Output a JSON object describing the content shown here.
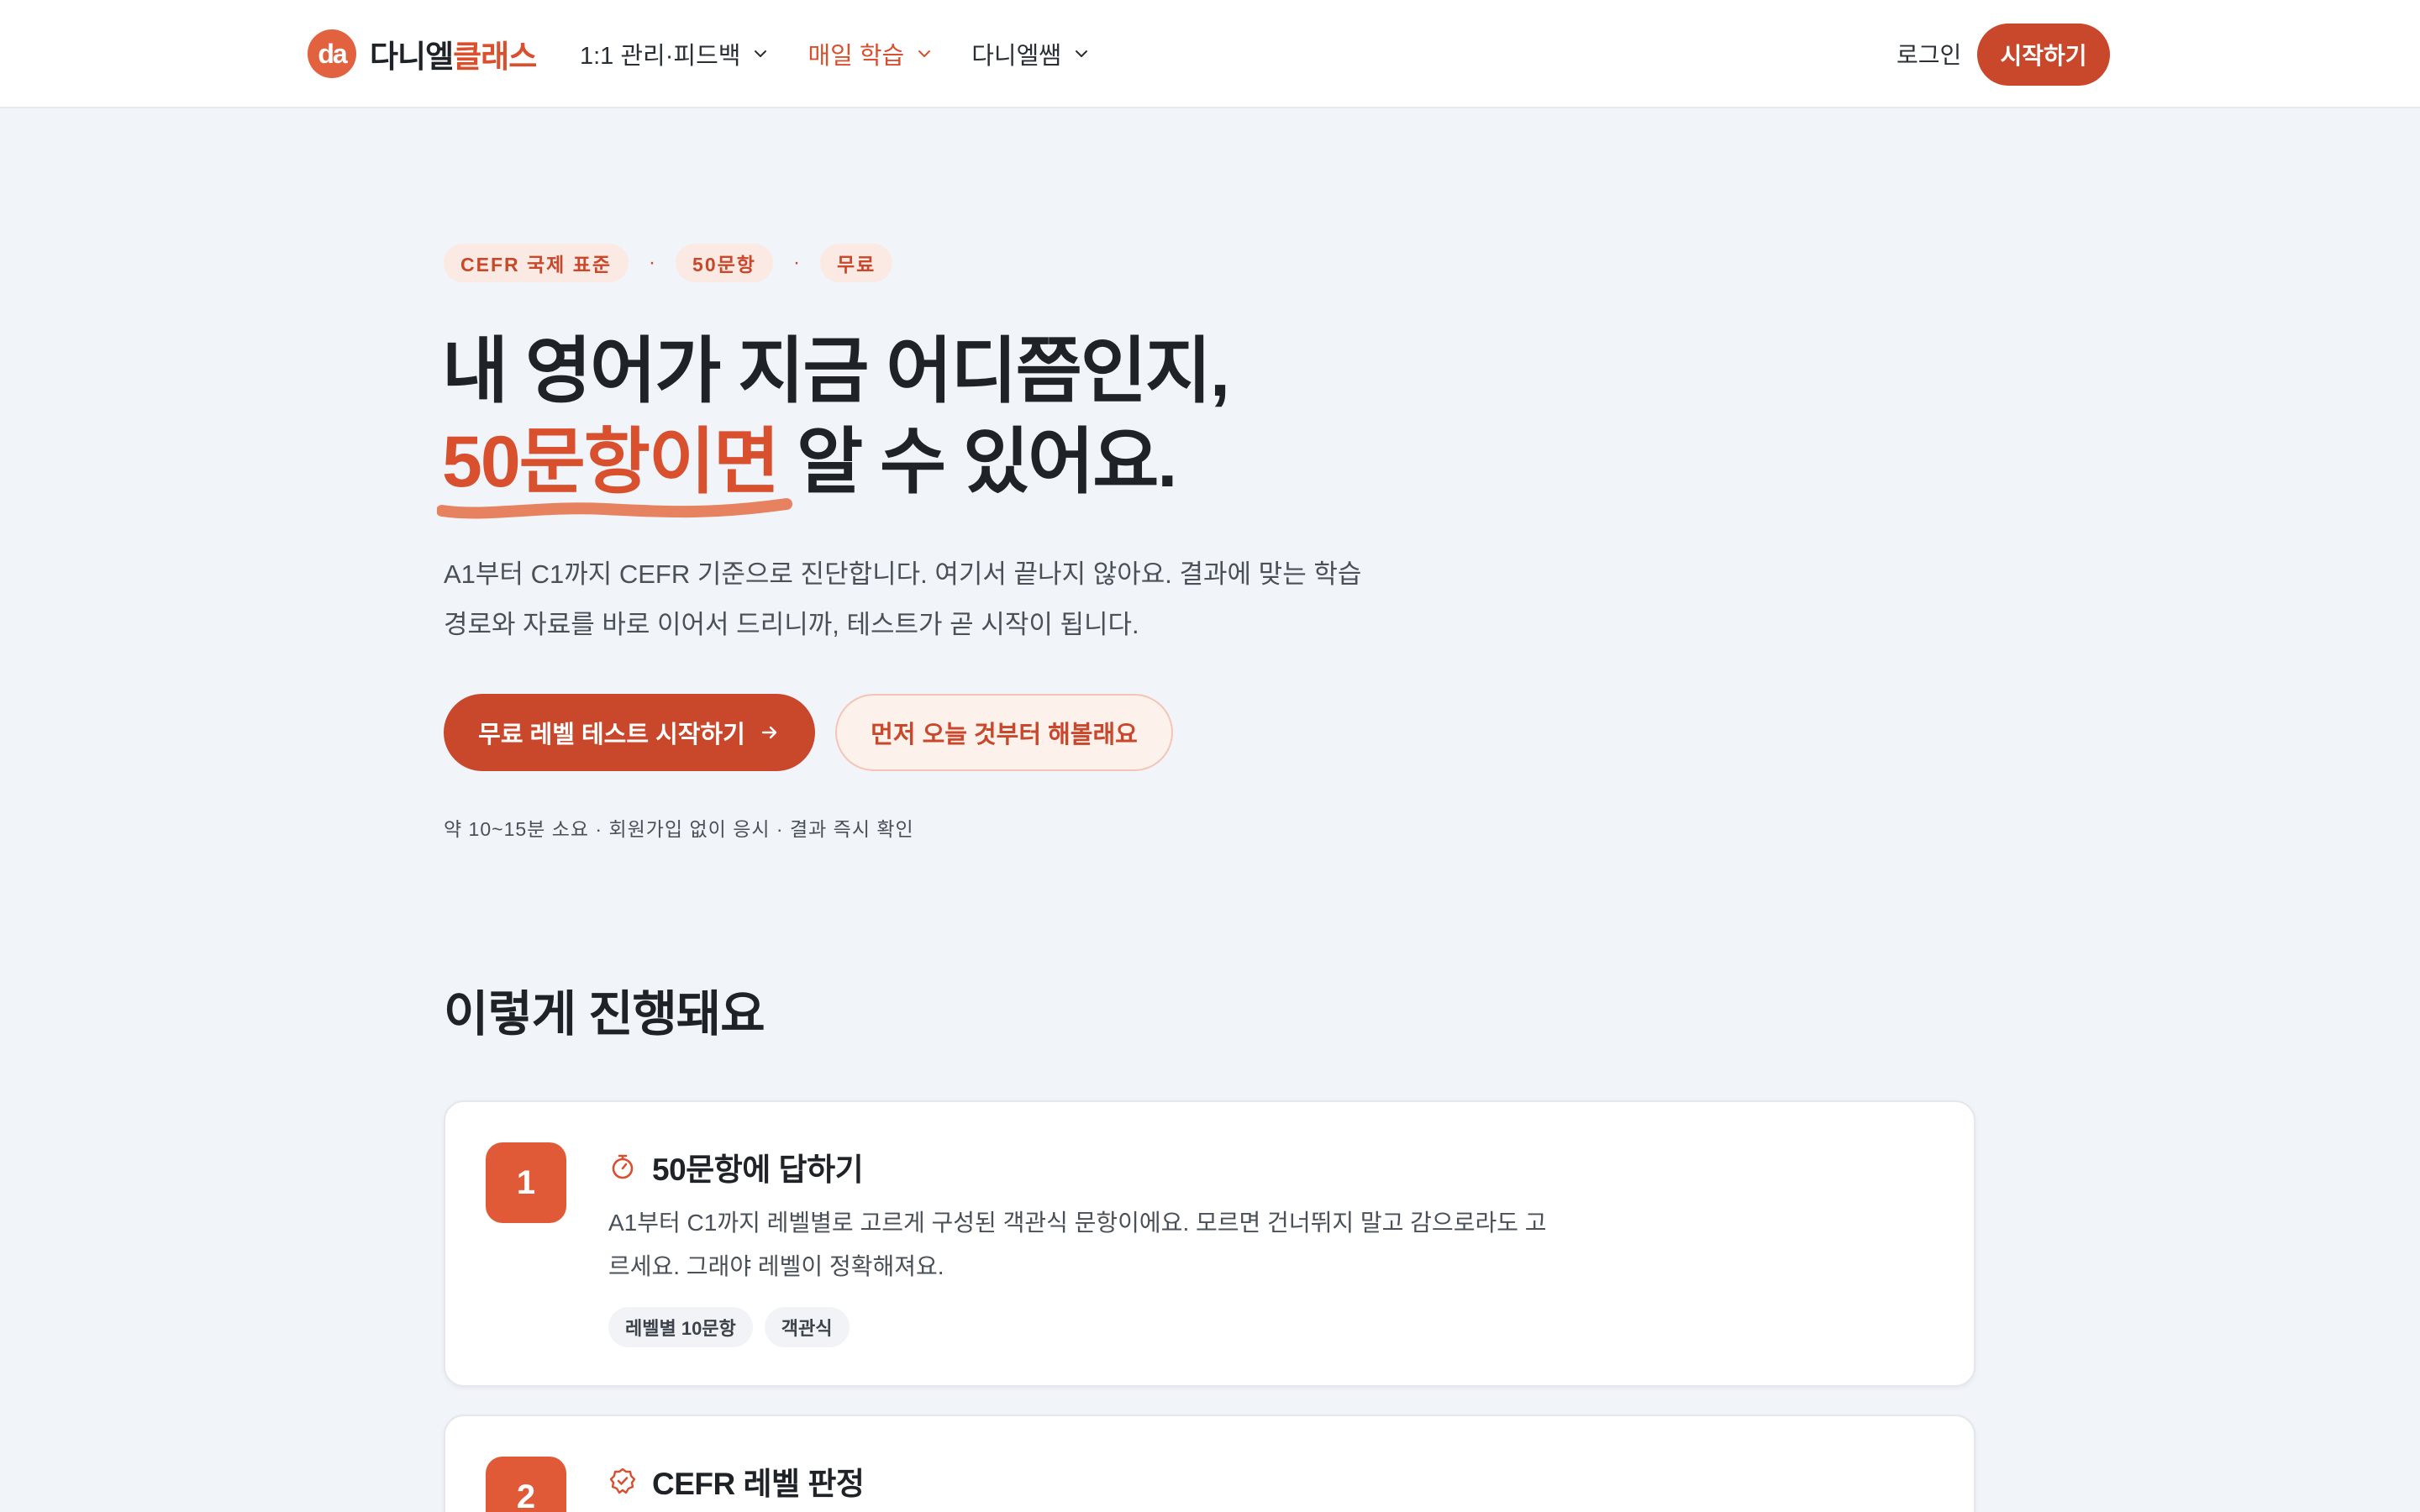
{
  "header": {
    "logo_mark": "da",
    "logo_text_1": "다니엘",
    "logo_text_2": "클래스",
    "nav": [
      {
        "label": "1:1 관리·피드백"
      },
      {
        "label": "매일 학습"
      },
      {
        "label": "다니엘쌤"
      }
    ],
    "login_label": "로그인",
    "start_label": "시작하기"
  },
  "hero": {
    "chips": [
      "CEFR 국제 표준",
      "50문항",
      "무료"
    ],
    "chip_separator": "·",
    "title_line1": "내 영어가 지금 어디쯤인지,",
    "title_accent": "50문항이면",
    "title_line2_rest": " 알 수 있어요.",
    "description": "A1부터 C1까지 CEFR 기준으로 진단합니다. 여기서 끝나지 않아요. 결과에 맞는 학습 경로와 자료를 바로 이어서 드리니까, 테스트가 곧 시작이 됩니다.",
    "primary_cta": "무료 레벨 테스트 시작하기",
    "secondary_cta": "먼저 오늘 것부터 해볼래요",
    "note": "약 10~15분 소요 · 회원가입 없이 응시 · 결과 즉시 확인"
  },
  "process": {
    "title": "이렇게 진행돼요",
    "steps": [
      {
        "number": "1",
        "icon": "stopwatch-icon",
        "title": "50문항에 답하기",
        "description": "A1부터 C1까지 레벨별로 고르게 구성된 객관식 문항이에요. 모르면 건너뛰지 말고 감으로라도 고르세요. 그래야 레벨이 정확해져요.",
        "tags": [
          "레벨별 10문항",
          "객관식"
        ]
      },
      {
        "number": "2",
        "icon": "badge-check-icon",
        "title": "CEFR 레벨 판정"
      }
    ]
  },
  "colors": {
    "accent": "#c9472a",
    "accent_light": "#e05a38",
    "background": "#f1f4f8"
  }
}
